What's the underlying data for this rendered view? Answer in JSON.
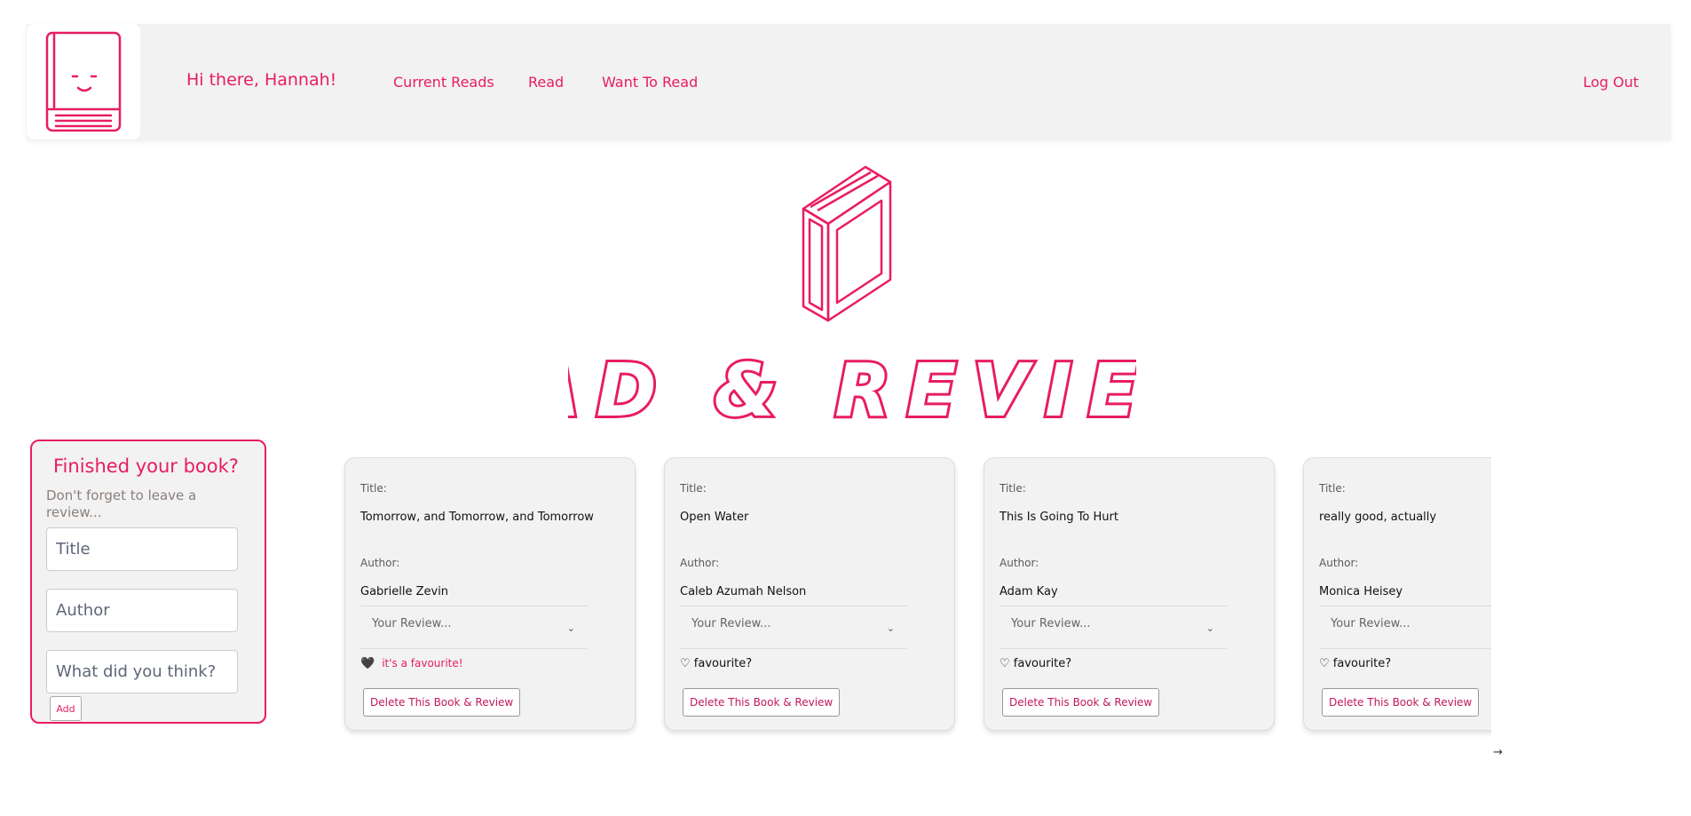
{
  "nav": {
    "greeting": "Hi there, Hannah!",
    "links": [
      "Current Reads",
      "Read",
      "Want To Read"
    ],
    "logout": "Log Out"
  },
  "hero": {
    "title": "READ & REVIEWS"
  },
  "form": {
    "title": "Finished your book?",
    "subtitle": "Don't forget to leave a review...",
    "title_placeholder": "Title",
    "author_placeholder": "Author",
    "review_placeholder": "What did you think?",
    "add_label": "Add"
  },
  "card_labels": {
    "title_label": "Title:",
    "author_label": "Author:",
    "review_placeholder": "Your Review...",
    "delete_label": "Delete This Book & Review"
  },
  "books": [
    {
      "title": "Tomorrow, and Tomorrow, and Tomorrow",
      "author": "Gabrielle Zevin",
      "favourite": true,
      "fav_icon": "🖤",
      "fav_text": "it's a favourite!"
    },
    {
      "title": "Open Water",
      "author": "Caleb Azumah Nelson",
      "favourite": false,
      "fav_icon": "♡",
      "fav_text": "favourite?"
    },
    {
      "title": "This Is Going To Hurt",
      "author": "Adam Kay",
      "favourite": false,
      "fav_icon": "♡",
      "fav_text": "favourite?"
    },
    {
      "title": "really good, actually",
      "author": "Monica Heisey",
      "favourite": false,
      "fav_icon": "♡",
      "fav_text": "favourite?"
    }
  ],
  "scroll_arrow": "→",
  "colors": {
    "accent": "#e81c63",
    "panel": "#f2f2f2"
  }
}
